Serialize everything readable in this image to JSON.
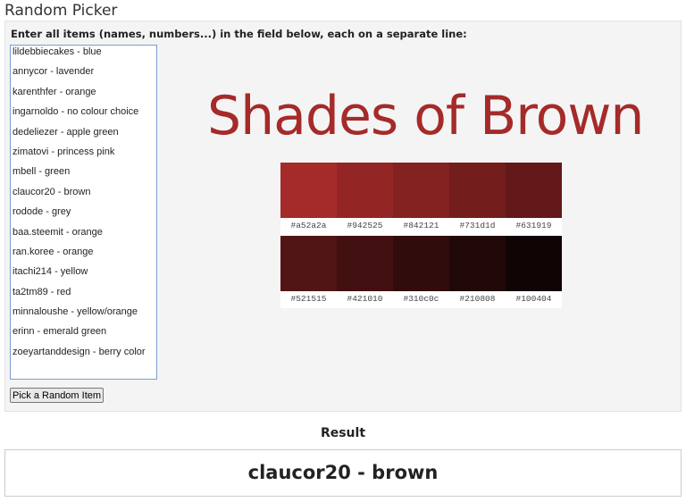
{
  "title": "Random Picker",
  "instructions": "Enter all items (names, numbers...) in the field below, each on a separate line:",
  "items": [
    "lildebbiecakes - blue",
    "annycor - lavender",
    "karenthfer - orange",
    "ingarnoldo - no colour choice",
    "dedeliezer - apple green",
    "zimatovi - princess pink",
    "mbell - green",
    "claucor20 - brown",
    "rodode - grey",
    "baa.steemit - orange",
    "ran.koree - orange",
    "itachi214 - yellow",
    "ta2tm89 - red",
    "minnaloushe - yellow/orange",
    "erinn - emerald green",
    "zoeyartanddesign - berry color"
  ],
  "pick_button": "Pick a Random Item",
  "image": {
    "heading": "Shades of Brown",
    "swatches": [
      [
        "#a52a2a",
        "#942525",
        "#842121",
        "#731d1d",
        "#631919"
      ],
      [
        "#521515",
        "#421010",
        "#310c0c",
        "#210808",
        "#100404"
      ]
    ]
  },
  "result_label": "Result",
  "result": "claucor20 - brown"
}
